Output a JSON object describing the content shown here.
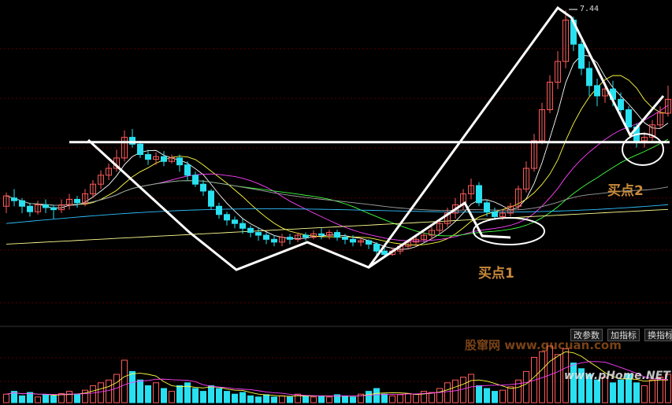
{
  "toolbar": {
    "modify_params": "改参数",
    "add_indicator": "加指标",
    "switch_indicator": "换指标"
  },
  "annotations": {
    "buy_point_1": "买点1",
    "buy_point_2": "买点2",
    "peak_price": "7.44"
  },
  "watermarks": {
    "gucuan": "股窜网 www.gucuan.com",
    "phome": "www.pHome.NET"
  },
  "colors": {
    "up": "#ff5a5a",
    "down": "#28e0f0",
    "ma5": "#ffffff",
    "ma10": "#ffff40",
    "ma20": "#ff40ff",
    "ma30": "#40ff40",
    "ma60": "#a0a0a0",
    "ma120": "#30c0ff",
    "ma250": "#ffff90",
    "label": "#c98a3a",
    "grid": "#b00000"
  },
  "chart_data": {
    "type": "candlestick",
    "peak_label": "7.44",
    "price_range": [
      3.2,
      7.5
    ],
    "support_level": 5.53,
    "candles": [
      [
        4.6,
        4.75,
        4.5,
        4.8
      ],
      [
        4.72,
        4.68,
        4.6,
        4.85
      ],
      [
        4.68,
        4.6,
        4.5,
        4.72
      ],
      [
        4.6,
        4.52,
        4.45,
        4.65
      ],
      [
        4.52,
        4.62,
        4.48,
        4.68
      ],
      [
        4.62,
        4.58,
        4.5,
        4.7
      ],
      [
        4.58,
        4.55,
        4.42,
        4.62
      ],
      [
        4.55,
        4.62,
        4.5,
        4.7
      ],
      [
        4.62,
        4.7,
        4.55,
        4.78
      ],
      [
        4.7,
        4.65,
        4.58,
        4.75
      ],
      [
        4.65,
        4.78,
        4.6,
        4.85
      ],
      [
        4.78,
        4.92,
        4.72,
        4.98
      ],
      [
        4.92,
        5.05,
        4.85,
        5.12
      ],
      [
        5.05,
        5.15,
        4.98,
        5.22
      ],
      [
        5.15,
        5.3,
        5.1,
        5.42
      ],
      [
        5.3,
        5.6,
        5.25,
        5.7
      ],
      [
        5.6,
        5.5,
        5.45,
        5.72
      ],
      [
        5.5,
        5.35,
        5.3,
        5.55
      ],
      [
        5.35,
        5.28,
        5.2,
        5.42
      ],
      [
        5.28,
        5.32,
        5.2,
        5.38
      ],
      [
        5.32,
        5.25,
        5.18,
        5.4
      ],
      [
        5.25,
        5.3,
        5.22,
        5.35
      ],
      [
        5.3,
        5.2,
        5.1,
        5.35
      ],
      [
        5.2,
        5.05,
        4.98,
        5.25
      ],
      [
        5.05,
        4.92,
        4.88,
        5.1
      ],
      [
        4.92,
        4.82,
        4.75,
        4.98
      ],
      [
        4.82,
        4.6,
        4.55,
        4.85
      ],
      [
        4.6,
        4.48,
        4.42,
        4.65
      ],
      [
        4.48,
        4.4,
        4.32,
        4.52
      ],
      [
        4.4,
        4.35,
        4.28,
        4.45
      ],
      [
        4.35,
        4.28,
        4.2,
        4.42
      ],
      [
        4.28,
        4.22,
        4.15,
        4.32
      ],
      [
        4.22,
        4.18,
        4.1,
        4.28
      ],
      [
        4.18,
        4.12,
        4.05,
        4.22
      ],
      [
        4.12,
        4.08,
        4.02,
        4.18
      ],
      [
        4.08,
        4.15,
        4.02,
        4.2
      ],
      [
        4.15,
        4.12,
        4.05,
        4.2
      ],
      [
        4.12,
        4.18,
        4.08,
        4.22
      ],
      [
        4.18,
        4.15,
        4.1,
        4.22
      ],
      [
        4.15,
        4.2,
        4.12,
        4.25
      ],
      [
        4.2,
        4.18,
        4.12,
        4.28
      ],
      [
        4.18,
        4.22,
        4.12,
        4.26
      ],
      [
        4.22,
        4.15,
        4.1,
        4.26
      ],
      [
        4.15,
        4.12,
        4.05,
        4.2
      ],
      [
        4.12,
        4.08,
        4.02,
        4.18
      ],
      [
        4.08,
        4.1,
        4.02,
        4.15
      ],
      [
        4.1,
        4.05,
        3.98,
        4.12
      ],
      [
        4.05,
        3.95,
        3.88,
        4.08
      ],
      [
        3.95,
        3.9,
        3.85,
        4.02
      ],
      [
        3.9,
        3.95,
        3.88,
        4.0
      ],
      [
        3.95,
        4.02,
        3.9,
        4.05
      ],
      [
        4.02,
        4.08,
        3.98,
        4.12
      ],
      [
        4.08,
        4.12,
        4.02,
        4.18
      ],
      [
        4.12,
        4.18,
        4.08,
        4.22
      ],
      [
        4.18,
        4.25,
        4.12,
        4.3
      ],
      [
        4.25,
        4.35,
        4.2,
        4.42
      ],
      [
        4.35,
        4.5,
        4.3,
        4.58
      ],
      [
        4.5,
        4.62,
        4.42,
        4.72
      ],
      [
        4.62,
        4.78,
        4.55,
        4.85
      ],
      [
        4.78,
        4.9,
        4.7,
        5.0
      ],
      [
        4.9,
        4.65,
        4.6,
        4.95
      ],
      [
        4.65,
        4.52,
        4.45,
        4.7
      ],
      [
        4.52,
        4.45,
        4.4,
        4.58
      ],
      [
        4.45,
        4.5,
        4.4,
        4.55
      ],
      [
        4.5,
        4.6,
        4.45,
        4.65
      ],
      [
        4.6,
        4.85,
        4.55,
        4.9
      ],
      [
        4.85,
        5.15,
        4.8,
        5.25
      ],
      [
        5.15,
        5.55,
        5.1,
        5.65
      ],
      [
        5.55,
        6.0,
        5.5,
        6.1
      ],
      [
        6.0,
        6.4,
        5.95,
        6.5
      ],
      [
        6.4,
        6.7,
        6.3,
        6.85
      ],
      [
        6.7,
        7.3,
        6.6,
        7.44
      ],
      [
        7.3,
        6.95,
        6.85,
        7.35
      ],
      [
        6.95,
        6.6,
        6.5,
        7.0
      ],
      [
        6.6,
        6.35,
        6.2,
        6.7
      ],
      [
        6.35,
        6.2,
        6.05,
        6.45
      ],
      [
        6.2,
        6.3,
        6.1,
        6.4
      ],
      [
        6.3,
        6.15,
        6.05,
        6.42
      ],
      [
        6.15,
        6.0,
        5.9,
        6.25
      ],
      [
        6.0,
        5.75,
        5.65,
        6.05
      ],
      [
        5.75,
        5.55,
        5.45,
        5.8
      ],
      [
        5.55,
        5.6,
        5.45,
        5.68
      ],
      [
        5.6,
        5.78,
        5.55,
        5.85
      ],
      [
        5.78,
        5.95,
        5.72,
        6.05
      ],
      [
        5.95,
        6.15,
        5.9,
        6.35
      ]
    ],
    "volumes": [
      0.15,
      0.2,
      0.12,
      0.18,
      0.1,
      0.14,
      0.12,
      0.16,
      0.2,
      0.15,
      0.22,
      0.3,
      0.35,
      0.4,
      0.5,
      0.75,
      0.55,
      0.4,
      0.3,
      0.35,
      0.25,
      0.2,
      0.3,
      0.35,
      0.25,
      0.2,
      0.3,
      0.25,
      0.2,
      0.15,
      0.18,
      0.12,
      0.1,
      0.14,
      0.1,
      0.12,
      0.1,
      0.15,
      0.12,
      0.1,
      0.12,
      0.1,
      0.14,
      0.12,
      0.1,
      0.15,
      0.2,
      0.25,
      0.15,
      0.12,
      0.14,
      0.16,
      0.15,
      0.2,
      0.18,
      0.25,
      0.35,
      0.4,
      0.45,
      0.5,
      0.3,
      0.25,
      0.2,
      0.22,
      0.28,
      0.4,
      0.55,
      0.8,
      0.9,
      1.0,
      0.85,
      0.95,
      0.7,
      0.6,
      0.5,
      0.4,
      0.45,
      0.35,
      0.4,
      0.5,
      0.35,
      0.3,
      0.4,
      0.45,
      0.5
    ]
  }
}
